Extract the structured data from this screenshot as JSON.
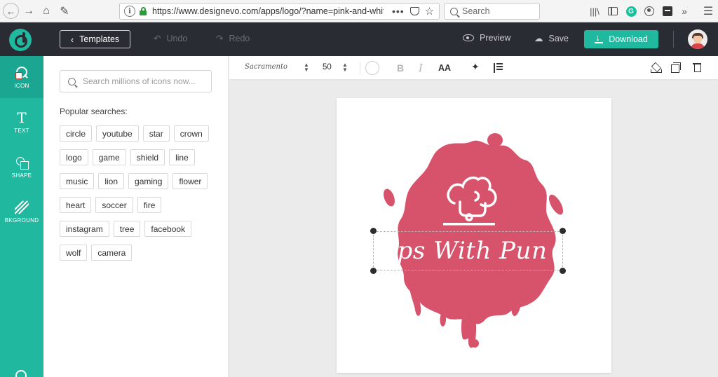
{
  "browser": {
    "url": "https://www.designevo.com/apps/logo/?name=pink-and-white-",
    "search_placeholder": "Search",
    "url_menu_dots": "•••"
  },
  "header": {
    "templates_label": "Templates",
    "undo_label": "Undo",
    "redo_label": "Redo",
    "preview_label": "Preview",
    "save_label": "Save",
    "download_label": "Download"
  },
  "tools": [
    {
      "label": "ICON"
    },
    {
      "label": "TEXT"
    },
    {
      "label": "SHAPE"
    },
    {
      "label": "BKGROUND"
    }
  ],
  "icon_panel": {
    "search_placeholder": "Search millions of icons now...",
    "popular_label": "Popular searches:",
    "tags": [
      [
        "circle",
        "youtube",
        "star",
        "crown"
      ],
      [
        "logo",
        "game",
        "shield",
        "line"
      ],
      [
        "music",
        "lion",
        "gaming",
        "flower"
      ],
      [
        "heart",
        "soccer",
        "fire"
      ],
      [
        "instagram",
        "tree",
        "facebook"
      ],
      [
        "wolf",
        "camera"
      ]
    ]
  },
  "text_toolbar": {
    "font_name": "Sacramento",
    "font_size": "50",
    "caps_label": "AA",
    "bold_label": "B",
    "italic_label": "I"
  },
  "canvas": {
    "logo_text": "Tips With Pun",
    "blob_color": "#d6536b",
    "accent": "#21b8a0"
  },
  "colors": {
    "app_header": "#2a2c33",
    "tool_rail": "#21b8a0",
    "download_button": "#21b8a0"
  }
}
